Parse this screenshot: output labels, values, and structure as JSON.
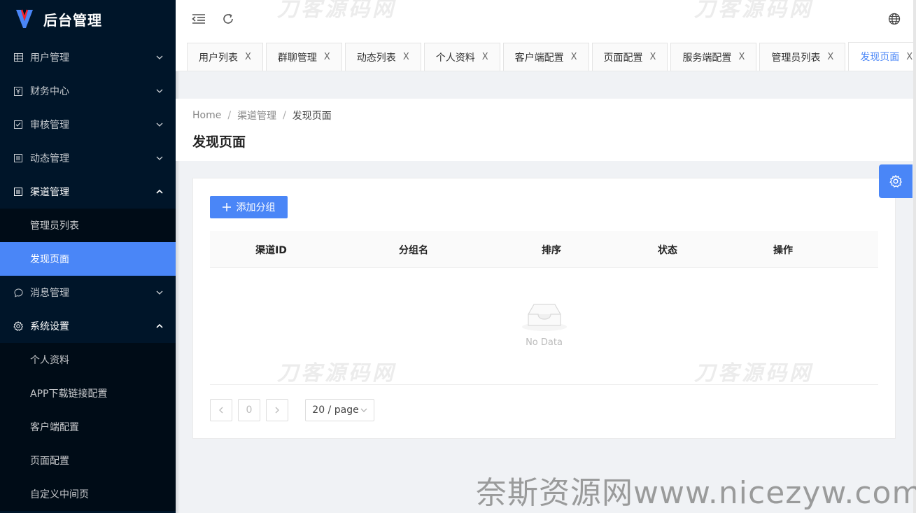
{
  "app": {
    "title": "后台管理"
  },
  "sidebar": {
    "menus": [
      {
        "label": "用户管理",
        "icon": "table-icon",
        "open": false
      },
      {
        "label": "财务中心",
        "icon": "finance-icon",
        "open": false
      },
      {
        "label": "审核管理",
        "icon": "checkbox-icon",
        "open": false
      },
      {
        "label": "动态管理",
        "icon": "list-icon",
        "open": false
      },
      {
        "label": "渠道管理",
        "icon": "list-icon",
        "open": true,
        "children": [
          "管理员列表",
          "发现页面"
        ]
      },
      {
        "label": "消息管理",
        "icon": "message-icon",
        "open": false
      },
      {
        "label": "系统设置",
        "icon": "gear-icon",
        "open": true,
        "children": [
          "个人资料",
          "APP下载链接配置",
          "客户端配置",
          "页面配置",
          "自定义中间页"
        ]
      }
    ],
    "active_item": "发现页面"
  },
  "tabs": [
    {
      "label": "用户列表"
    },
    {
      "label": "群聊管理"
    },
    {
      "label": "动态列表"
    },
    {
      "label": "个人资料"
    },
    {
      "label": "客户端配置"
    },
    {
      "label": "页面配置"
    },
    {
      "label": "服务端配置"
    },
    {
      "label": "管理员列表"
    },
    {
      "label": "发现页面",
      "active": true
    }
  ],
  "tab_close_glyph": "X",
  "breadcrumb": {
    "home": "Home",
    "parent": "渠道管理",
    "current": "发现页面",
    "sep": "/"
  },
  "page": {
    "title": "发现页面"
  },
  "toolbar": {
    "add_label": "添加分组"
  },
  "table": {
    "columns": [
      "渠道ID",
      "分组名",
      "排序",
      "状态",
      "操作"
    ],
    "rows": [],
    "empty_text": "No Data"
  },
  "pagination": {
    "current_page": "0",
    "page_size": "20 / page"
  },
  "watermarks": {
    "small": "刀客源码网",
    "big": "奈斯资源网www.nicezyw.com"
  },
  "colors": {
    "primary": "#4a86f7",
    "sidebar_bg": "#001529"
  }
}
